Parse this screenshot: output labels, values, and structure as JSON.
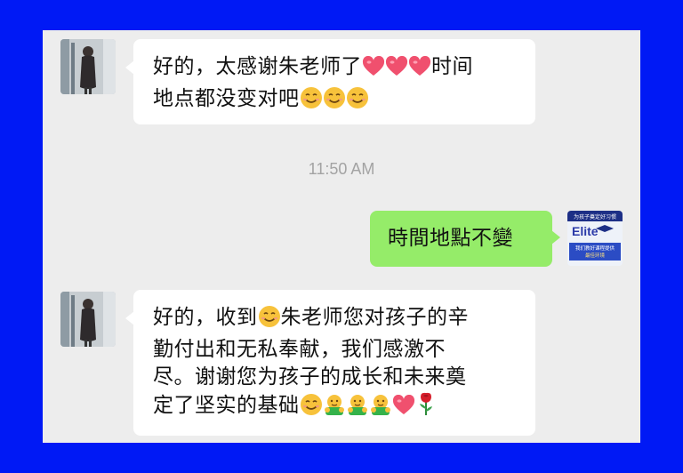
{
  "messages": [
    {
      "direction": "incoming",
      "line1": "好的，太感谢朱老师了",
      "line1_suffix": "时间",
      "line2": "地点都没变对吧",
      "emojis_line1": [
        "heart-icon",
        "heart-icon",
        "heart-icon"
      ],
      "emojis_line2": [
        "smile-icon",
        "smile-icon",
        "smile-icon"
      ]
    },
    {
      "direction": "outgoing",
      "text": "時間地點不變"
    },
    {
      "direction": "incoming",
      "line1_a": "好的，收到",
      "line1_b": "朱老师您对孩子的辛",
      "line2": "勤付出和无私奉献，我们感激不",
      "line3": "尽。谢谢您为孩子的成长和未来奠",
      "line4": "定了坚实的基础",
      "emojis_line4": [
        "smile-icon",
        "hug-icon",
        "hug-icon",
        "hug-icon",
        "heart-icon",
        "rose-icon"
      ]
    }
  ],
  "timestamp": "11:50 AM",
  "poster": {
    "top_text": "为孩子奠定好习惯",
    "brand": "Elite",
    "sub_line1": "我们教好课程提供",
    "sub_line2": "最佳环境"
  },
  "colors": {
    "background": "#0019f5",
    "chat_bg": "#ededed",
    "outgoing_bubble": "#95ec69",
    "incoming_bubble": "#ffffff",
    "heart": "#f0506e"
  }
}
